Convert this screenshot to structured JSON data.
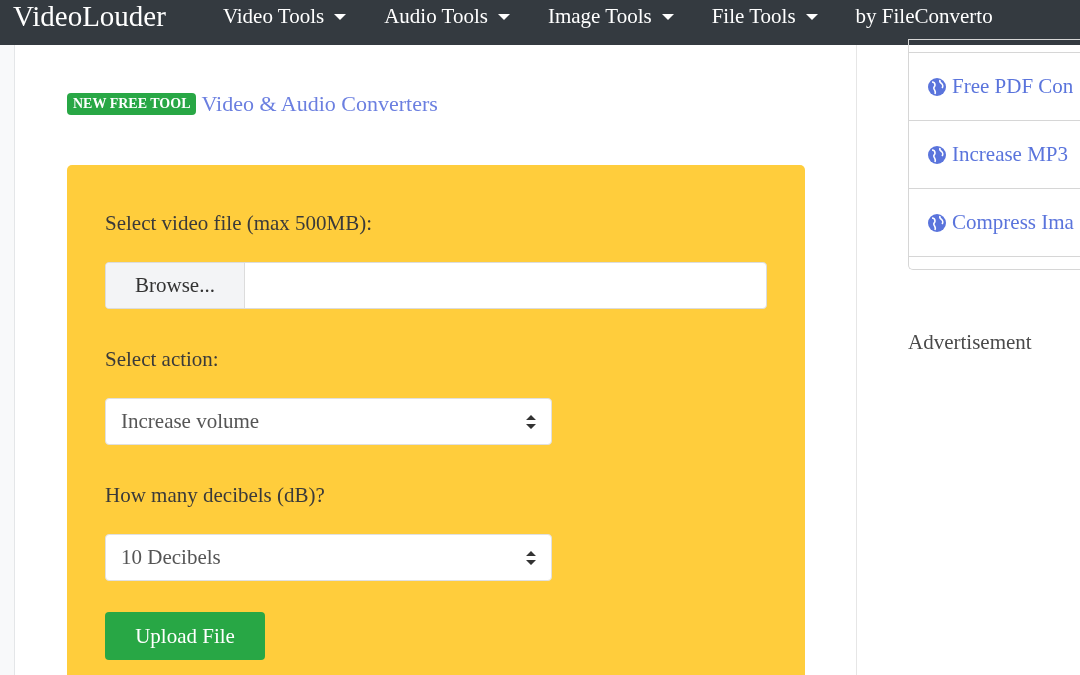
{
  "navbar": {
    "brand": "VideoLouder",
    "items": [
      {
        "label": "Video Tools",
        "dropdown": true
      },
      {
        "label": "Audio Tools",
        "dropdown": true
      },
      {
        "label": "Image Tools",
        "dropdown": true
      },
      {
        "label": "File Tools",
        "dropdown": true
      },
      {
        "label": "by FileConverto",
        "dropdown": false
      }
    ]
  },
  "promo": {
    "badge": "NEW FREE TOOL",
    "link": "Video & Audio Converters"
  },
  "form": {
    "fields": [
      {
        "kind": "file",
        "label": "Select video file (max 500MB):",
        "button": "Browse..."
      },
      {
        "kind": "select",
        "label": "Select action:",
        "value": "Increase volume"
      },
      {
        "kind": "select",
        "label": "How many decibels (dB)?",
        "value": "10 Decibels"
      }
    ],
    "submit": "Upload File"
  },
  "sidebar": {
    "links": [
      "Free PDF Con",
      "Increase MP3",
      "Compress Ima"
    ],
    "advertisement": "Advertisement"
  }
}
